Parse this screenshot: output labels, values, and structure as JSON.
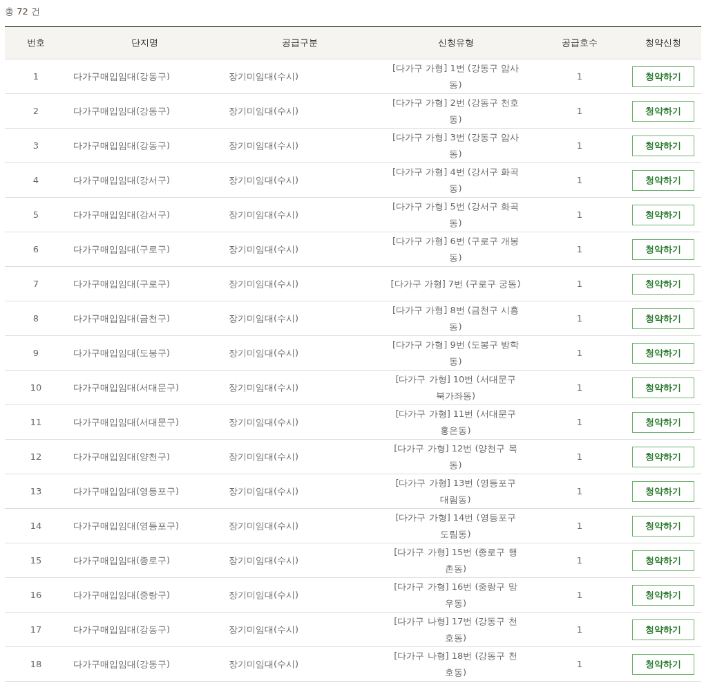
{
  "total": "총 **72** 건",
  "table": {
    "columns": [
      "번호",
      "단지명",
      "공급구분",
      "신청유형",
      "공급호수",
      "청약신청"
    ],
    "rows": [
      {
        "no": "1",
        "complex": "다가구매입임대(강동구)",
        "supply": "장기미임대(수시)",
        "type": "[다가구 가형] 1번 (강동구 암사동)",
        "units": "1",
        "action": "청약하기"
      },
      {
        "no": "2",
        "complex": "다가구매입임대(강동구)",
        "supply": "장기미임대(수시)",
        "type": "[다가구 가형] 2번 (강동구 천호동)",
        "units": "1",
        "action": "청약하기"
      },
      {
        "no": "3",
        "complex": "다가구매입임대(강동구)",
        "supply": "장기미임대(수시)",
        "type": "[다가구 가형] 3번 (강동구 암사동)",
        "units": "1",
        "action": "청약하기"
      },
      {
        "no": "4",
        "complex": "다가구매입임대(강서구)",
        "supply": "장기미임대(수시)",
        "type": "[다가구 가형] 4번 (강서구 화곡동)",
        "units": "1",
        "action": "청약하기"
      },
      {
        "no": "5",
        "complex": "다가구매입임대(강서구)",
        "supply": "장기미임대(수시)",
        "type": "[다가구 가형] 5번 (강서구 화곡동)",
        "units": "1",
        "action": "청약하기"
      },
      {
        "no": "6",
        "complex": "다가구매입임대(구로구)",
        "supply": "장기미임대(수시)",
        "type": "[다가구 가형] 6번 (구로구 개봉동)",
        "units": "1",
        "action": "청약하기"
      },
      {
        "no": "7",
        "complex": "다가구매입임대(구로구)",
        "supply": "장기미임대(수시)",
        "type": "[다가구 가형] 7번 (구로구 궁동)",
        "units": "1",
        "action": "청약하기"
      },
      {
        "no": "8",
        "complex": "다가구매입임대(금천구)",
        "supply": "장기미임대(수시)",
        "type": "[다가구 가형] 8번 (금천구 시흥동)",
        "units": "1",
        "action": "청약하기"
      },
      {
        "no": "9",
        "complex": "다가구매입임대(도봉구)",
        "supply": "장기미임대(수시)",
        "type": "[다가구 가형] 9번 (도봉구 방학동)",
        "units": "1",
        "action": "청약하기"
      },
      {
        "no": "10",
        "complex": "다가구매입임대(서대문구)",
        "supply": "장기미임대(수시)",
        "type": "[다가구 가형] 10번 (서대문구 북가좌동)",
        "units": "1",
        "action": "청약하기"
      },
      {
        "no": "11",
        "complex": "다가구매입임대(서대문구)",
        "supply": "장기미임대(수시)",
        "type": "[다가구 가형] 11번 (서대문구 홍은동)",
        "units": "1",
        "action": "청약하기"
      },
      {
        "no": "12",
        "complex": "다가구매입임대(양천구)",
        "supply": "장기미임대(수시)",
        "type": "[다가구 가형] 12번 (양천구 목동)",
        "units": "1",
        "action": "청약하기"
      },
      {
        "no": "13",
        "complex": "다가구매입임대(영등포구)",
        "supply": "장기미임대(수시)",
        "type": "[다가구 가형] 13번 (영등포구 대림동)",
        "units": "1",
        "action": "청약하기"
      },
      {
        "no": "14",
        "complex": "다가구매입임대(영등포구)",
        "supply": "장기미임대(수시)",
        "type": "[다가구 가형] 14번 (영등포구 도림동)",
        "units": "1",
        "action": "청약하기"
      },
      {
        "no": "15",
        "complex": "다가구매입임대(종로구)",
        "supply": "장기미임대(수시)",
        "type": "[다가구 가형] 15번 (종로구 행촌동)",
        "units": "1",
        "action": "청약하기"
      },
      {
        "no": "16",
        "complex": "다가구매입임대(중랑구)",
        "supply": "장기미임대(수시)",
        "type": "[다가구 가형] 16번 (중랑구 망우동)",
        "units": "1",
        "action": "청약하기"
      },
      {
        "no": "17",
        "complex": "다가구매입임대(강동구)",
        "supply": "장기미임대(수시)",
        "type": "[다가구 나형] 17번 (강동구 천호동)",
        "units": "1",
        "action": "청약하기"
      },
      {
        "no": "18",
        "complex": "다가구매입임대(강동구)",
        "supply": "장기미임대(수시)",
        "type": "[다가구 나형] 18번 (강동구 천호동)",
        "units": "1",
        "action": "청약하기"
      }
    ]
  }
}
